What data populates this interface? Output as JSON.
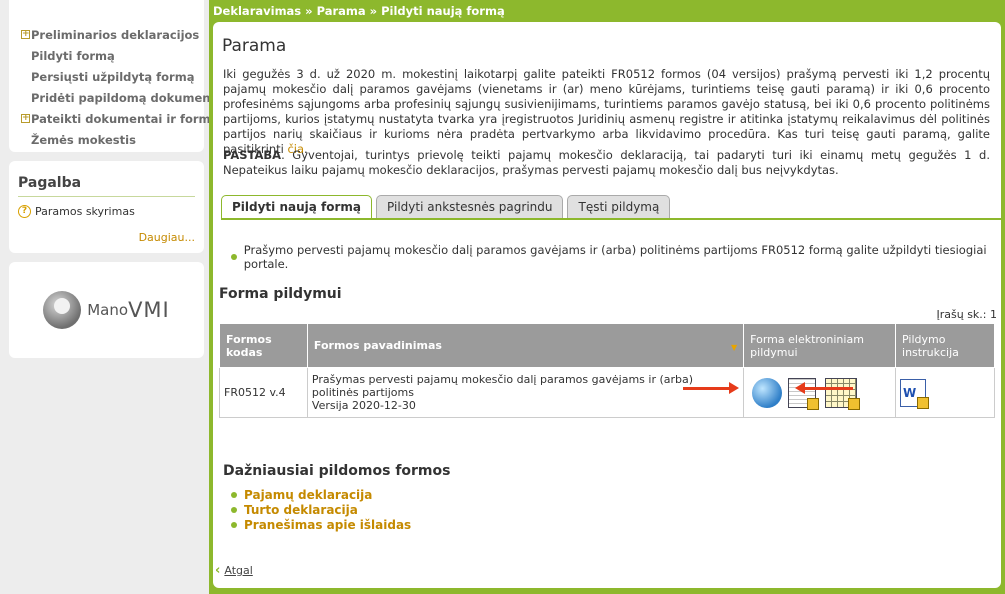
{
  "breadcrumb": "Deklaravimas » Parama » Pildyti naują formą",
  "sidebar": {
    "items": [
      {
        "label": "Preliminarios deklaracijos",
        "expandable": true
      },
      {
        "label": "Pildyti formą",
        "expandable": false
      },
      {
        "label": "Persiųsti užpildytą formą",
        "expandable": false
      },
      {
        "label": "Pridėti papildomą dokumentą",
        "expandable": false
      },
      {
        "label": "Pateikti dokumentai ir formos",
        "expandable": true
      },
      {
        "label": "Žemės mokestis",
        "expandable": false
      }
    ],
    "help": {
      "title": "Pagalba",
      "link": "Paramos skyrimas",
      "more": "Daugiau..."
    },
    "logo": {
      "text1": "Mano",
      "text2": "VMI"
    }
  },
  "page": {
    "title": "Parama",
    "intro": "Iki gegužės 3 d. už 2020 m. mokestinį laikotarpį galite pateikti FR0512 formos (04 versijos) prašymą pervesti iki 1,2 procentų pajamų mokesčio dalį paramos gavėjams (vienetams ir (ar) meno kūrėjams, turintiems teisę gauti paramą) ir iki 0,6 procento profesinėms sąjungoms arba profesinių sąjungų susivienijimams, turintiems paramos gavėjo statusą, bei iki 0,6 procento politinėms partijoms, kurios įstatymų nustatyta tvarka yra įregistruotos Juridinių asmenų registre ir atitinka įstatymų reikalavimus dėl politinės partijos narių skaičiaus ir kurioms nėra pradėta pertvarkymo arba likvidavimo procedūra. Kas turi teisę gauti paramą, galite pasitikrinti ",
    "intro_link": "čia",
    "intro_end": ".",
    "note_bold": "PASTABA",
    "note_text": ". Gyventojai, turintys prievolę teikti pajamų mokesčio deklaraciją, tai padaryti turi iki einamų metų gegužės 1 d. Nepateikus laiku pajamų mokesčio deklaracijos, prašymas pervesti pajamų mokesčio dalį bus neįvykdytas."
  },
  "tabs": [
    {
      "label": "Pildyti naują formą",
      "active": true
    },
    {
      "label": "Pildyti ankstesnės pagrindu",
      "active": false
    },
    {
      "label": "Tęsti pildymą",
      "active": false
    }
  ],
  "bullet": "Prašymo pervesti pajamų mokesčio dalį paramos gavėjams ir (arba) politinėms partijoms FR0512 formą galite užpildyti tiesiogiai portale.",
  "forms_section": {
    "title": "Forma pildymui",
    "count": "Įrašų sk.: 1",
    "columns": [
      "Formos kodas",
      "Formos pavadinimas",
      "Forma elektroniniam pildymui",
      "Pildymo instrukcija"
    ],
    "rows": [
      {
        "code": "FR0512 v.4",
        "name": "Prašymas pervesti pajamų mokesčio dalį paramos gavėjams ir (arba) politinės partijoms",
        "version": "Versija 2020-12-30"
      }
    ]
  },
  "frequent": {
    "title": "Dažniausiai pildomos formos",
    "items": [
      "Pajamų deklaracija",
      "Turto deklaracija",
      "Pranešimas apie išlaidas"
    ]
  },
  "back_label": "Atgal"
}
